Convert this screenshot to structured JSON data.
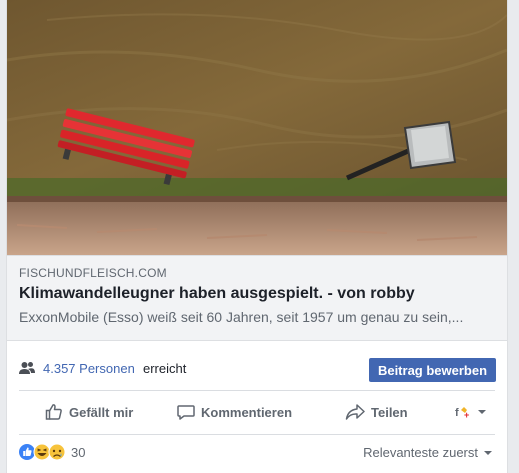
{
  "post": {
    "photo": {
      "icon": "flooded-park-bench-photo"
    },
    "link": {
      "domain": "FISCHUNDFLEISCH.COM",
      "title": "Klimawandelleugner haben ausgespielt. - von robby",
      "description": "ExxonMobile (Esso) weiß seit 60 Jahren, seit 1957 um genau zu sein,..."
    },
    "reach": {
      "icon": "people-icon",
      "count_text": "4.357 Personen",
      "suffix": "erreicht",
      "boost_label": "Beitrag bewerben"
    },
    "actions": {
      "like_label": "Gefällt mir",
      "comment_label": "Kommentieren",
      "share_label": "Teilen"
    },
    "reactions": {
      "icons": [
        "like-reaction-icon",
        "haha-reaction-icon",
        "sad-reaction-icon"
      ],
      "count": "30",
      "sort_label": "Relevanteste zuerst"
    }
  },
  "colors": {
    "link_blue": "#4267b2",
    "button_blue": "#4267b2",
    "bench_red": "#e0282e",
    "water_brown": "#7a6134"
  }
}
